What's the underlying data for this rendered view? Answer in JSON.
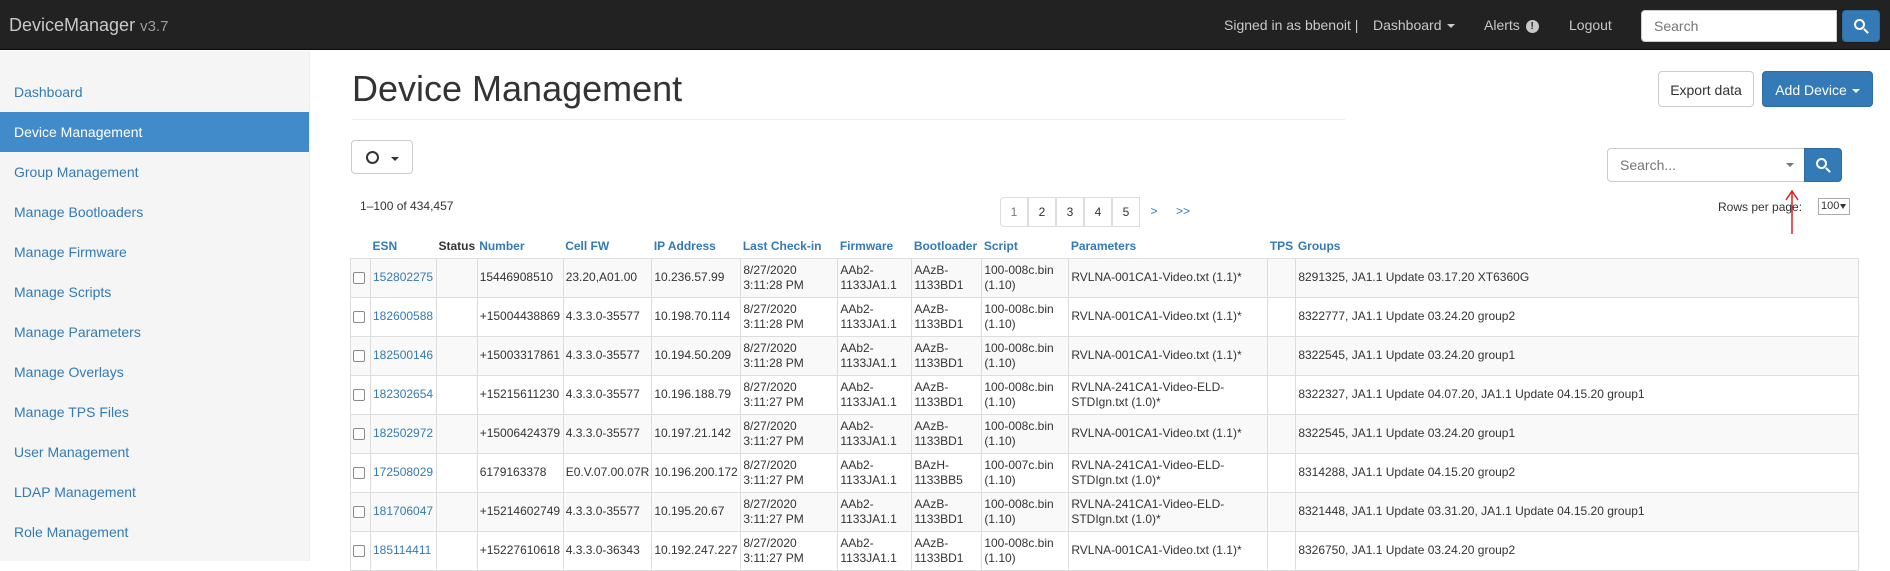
{
  "navbar": {
    "brand": "DeviceManager",
    "version": "v3.7",
    "signed_in": "Signed in as bbenoit |",
    "dashboard_label": "Dashboard",
    "alerts_label": "Alerts",
    "logout_label": "Logout",
    "search_placeholder": "Search"
  },
  "sidebar": {
    "items": [
      {
        "label": "Dashboard",
        "active": false
      },
      {
        "label": "Device Management",
        "active": true
      },
      {
        "label": "Group Management",
        "active": false
      },
      {
        "label": "Manage Bootloaders",
        "active": false
      },
      {
        "label": "Manage Firmware",
        "active": false
      },
      {
        "label": "Manage Scripts",
        "active": false
      },
      {
        "label": "Manage Parameters",
        "active": false
      },
      {
        "label": "Manage Overlays",
        "active": false
      },
      {
        "label": "Manage TPS Files",
        "active": false
      },
      {
        "label": "User Management",
        "active": false
      },
      {
        "label": "LDAP Management",
        "active": false
      },
      {
        "label": "Role Management",
        "active": false
      }
    ]
  },
  "main": {
    "title": "Device Management",
    "export_label": "Export data",
    "add_device_label": "Add Device",
    "count_text": "1–100 of 434,457",
    "pagination": [
      "1",
      "2",
      "3",
      "4",
      "5",
      ">",
      ">>"
    ],
    "current_page": "1",
    "grid_search_placeholder": "Search...",
    "rows_per_page_label": "Rows per page:",
    "rows_per_page_value": "100"
  },
  "table": {
    "columns": [
      "ESN",
      "Status",
      "Number",
      "Cell FW",
      "IP Address",
      "Last Check-in",
      "Firmware",
      "Bootloader",
      "Script",
      "Parameters",
      "TPS",
      "Groups"
    ],
    "rows": [
      {
        "esn": "152802275",
        "status": "",
        "number": "15446908510",
        "cell_fw": "23.20,A01.00",
        "ip": "10.236.57.99",
        "checkin_date": "8/27/2020",
        "checkin_time": "3:11:28 PM",
        "fw1": "AAb2-",
        "fw2": "1133JA1.1",
        "bl1": "AAzB-",
        "bl2": "1133BD1",
        "sc1": "100-008c.bin",
        "sc2": "(1.10)",
        "p1": "RVLNA-001CA1-Video.txt (1.1)*",
        "p2": "",
        "tps": "",
        "groups": "8291325, JA1.1 Update 03.17.20 XT6360G"
      },
      {
        "esn": "182600588",
        "status": "",
        "number": "+15004438869",
        "cell_fw": "4.3.3.0-35577",
        "ip": "10.198.70.114",
        "checkin_date": "8/27/2020",
        "checkin_time": "3:11:28 PM",
        "fw1": "AAb2-",
        "fw2": "1133JA1.1",
        "bl1": "AAzB-",
        "bl2": "1133BD1",
        "sc1": "100-008c.bin",
        "sc2": "(1.10)",
        "p1": "RVLNA-001CA1-Video.txt (1.1)*",
        "p2": "",
        "tps": "",
        "groups": "8322777, JA1.1 Update 03.24.20 group2"
      },
      {
        "esn": "182500146",
        "status": "",
        "number": "+15003317861",
        "cell_fw": "4.3.3.0-35577",
        "ip": "10.194.50.209",
        "checkin_date": "8/27/2020",
        "checkin_time": "3:11:28 PM",
        "fw1": "AAb2-",
        "fw2": "1133JA1.1",
        "bl1": "AAzB-",
        "bl2": "1133BD1",
        "sc1": "100-008c.bin",
        "sc2": "(1.10)",
        "p1": "RVLNA-001CA1-Video.txt (1.1)*",
        "p2": "",
        "tps": "",
        "groups": "8322545, JA1.1 Update 03.24.20 group1"
      },
      {
        "esn": "182302654",
        "status": "",
        "number": "+15215611230",
        "cell_fw": "4.3.3.0-35577",
        "ip": "10.196.188.79",
        "checkin_date": "8/27/2020",
        "checkin_time": "3:11:27 PM",
        "fw1": "AAb2-",
        "fw2": "1133JA1.1",
        "bl1": "AAzB-",
        "bl2": "1133BD1",
        "sc1": "100-008c.bin",
        "sc2": "(1.10)",
        "p1": "RVLNA-241CA1-Video-ELD-",
        "p2": "STDIgn.txt (1.0)*",
        "tps": "",
        "groups": "8322327, JA1.1 Update 04.07.20, JA1.1 Update 04.15.20 group1"
      },
      {
        "esn": "182502972",
        "status": "",
        "number": "+15006424379",
        "cell_fw": "4.3.3.0-35577",
        "ip": "10.197.21.142",
        "checkin_date": "8/27/2020",
        "checkin_time": "3:11:27 PM",
        "fw1": "AAb2-",
        "fw2": "1133JA1.1",
        "bl1": "AAzB-",
        "bl2": "1133BD1",
        "sc1": "100-008c.bin",
        "sc2": "(1.10)",
        "p1": "RVLNA-001CA1-Video.txt (1.1)*",
        "p2": "",
        "tps": "",
        "groups": "8322545, JA1.1 Update 03.24.20 group1"
      },
      {
        "esn": "172508029",
        "status": "",
        "number": "6179163378",
        "cell_fw": "E0.V.07.00.07R",
        "ip": "10.196.200.172",
        "checkin_date": "8/27/2020",
        "checkin_time": "3:11:27 PM",
        "fw1": "AAb2-",
        "fw2": "1133JA1.1",
        "bl1": "BAzH-",
        "bl2": "1133BB5",
        "sc1": "100-007c.bin",
        "sc2": "(1.10)",
        "p1": "RVLNA-241CA1-Video-ELD-",
        "p2": "STDIgn.txt (1.0)*",
        "tps": "",
        "groups": "8314288, JA1.1 Update 04.15.20 group2"
      },
      {
        "esn": "181706047",
        "status": "",
        "number": "+15214602749",
        "cell_fw": "4.3.3.0-35577",
        "ip": "10.195.20.67",
        "checkin_date": "8/27/2020",
        "checkin_time": "3:11:27 PM",
        "fw1": "AAb2-",
        "fw2": "1133JA1.1",
        "bl1": "AAzB-",
        "bl2": "1133BD1",
        "sc1": "100-008c.bin",
        "sc2": "(1.10)",
        "p1": "RVLNA-241CA1-Video-ELD-",
        "p2": "STDIgn.txt (1.0)*",
        "tps": "",
        "groups": "8321448, JA1.1 Update 03.31.20, JA1.1 Update 04.15.20 group1"
      },
      {
        "esn": "185114411",
        "status": "",
        "number": "+15227610618",
        "cell_fw": "4.3.3.0-36343",
        "ip": "10.192.247.227",
        "checkin_date": "8/27/2020",
        "checkin_time": "3:11:27 PM",
        "fw1": "AAb2-",
        "fw2": "1133JA1.1",
        "bl1": "AAzB-",
        "bl2": "1133BD1",
        "sc1": "100-008c.bin",
        "sc2": "(1.10)",
        "p1": "RVLNA-001CA1-Video.txt (1.1)*",
        "p2": "",
        "tps": "",
        "groups": "8326750, JA1.1 Update 03.24.20 group2"
      }
    ]
  }
}
